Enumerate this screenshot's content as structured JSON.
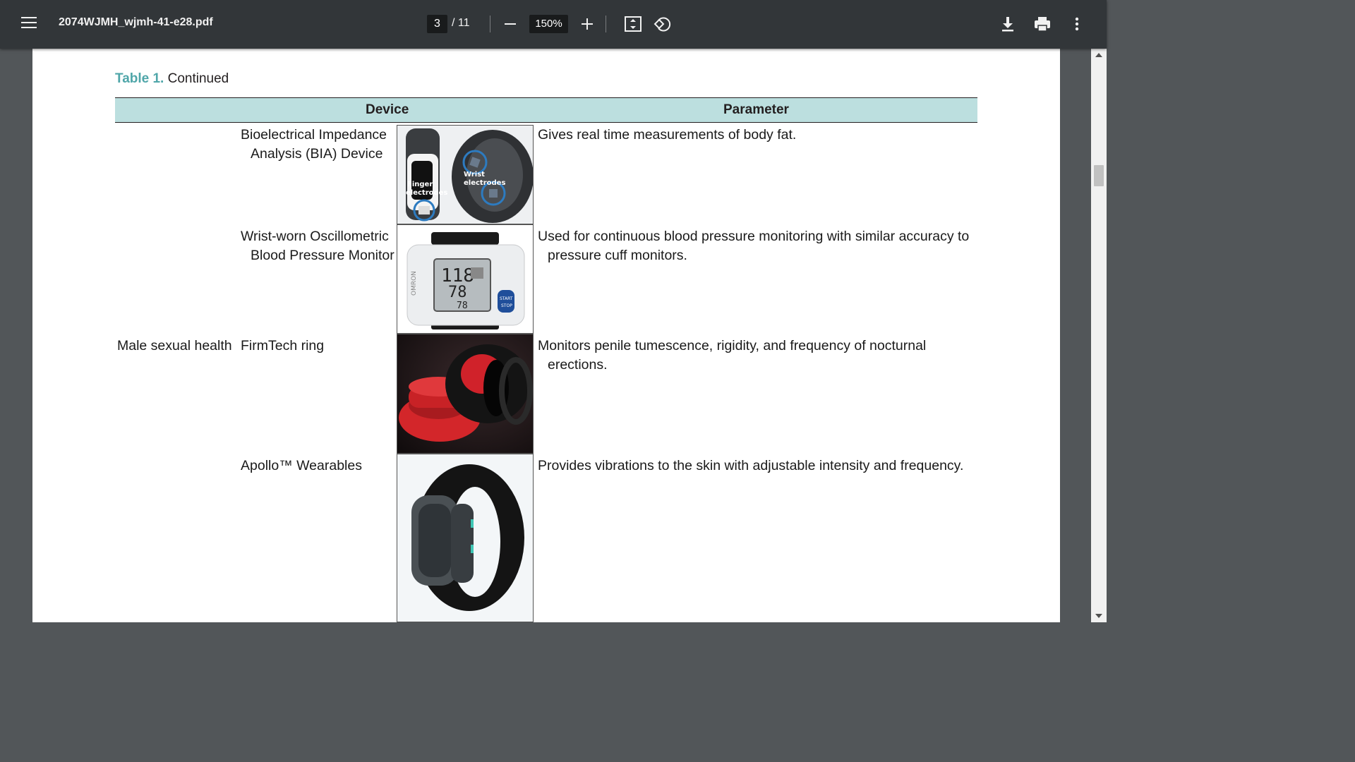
{
  "toolbar": {
    "file_name": "2074WJMH_wjmh-41-e28.pdf",
    "current_page": "3",
    "total_pages": "/ 11",
    "zoom": "150%"
  },
  "table": {
    "caption_label": "Table 1.",
    "caption_text": "Continued",
    "headers": {
      "device": "Device",
      "parameter": "Parameter"
    },
    "rows": [
      {
        "category": "",
        "device_line1": "Bioelectrical Impedance",
        "device_line2": "Analysis (BIA) Device",
        "param_line1": "Gives real time measurements of body fat.",
        "param_line2": "",
        "image_labels": {
          "finger": "Finger electrodes",
          "wrist": "Wrist electrodes"
        }
      },
      {
        "category": "",
        "device_line1": "Wrist-worn Oscillometric",
        "device_line2": "Blood Pressure Monitor",
        "param_line1": "Used for continuous blood pressure monitoring with similar accuracy to",
        "param_line2": "pressure cuff monitors.",
        "image_labels": {
          "brand": "OMRON",
          "sys": "118",
          "dia": "78",
          "pulse": "78",
          "button": "START STOP"
        }
      },
      {
        "category": "Male sexual health",
        "device_line1": "FirmTech ring",
        "device_line2": "",
        "param_line1": "Monitors penile tumescence, rigidity, and frequency of nocturnal",
        "param_line2": "erections."
      },
      {
        "category": "",
        "device_line1": "Apollo™ Wearables",
        "device_line2": "",
        "param_line1": "Provides vibrations to the skin with adjustable intensity and frequency.",
        "param_line2": ""
      }
    ]
  },
  "colors": {
    "toolbar_bg": "#323639",
    "viewer_bg": "#525659",
    "header_fill": "#bcdfdf",
    "caption_accent": "#4fa6a9"
  },
  "icons": [
    "menu-icon",
    "zoom-out-icon",
    "zoom-in-icon",
    "fit-page-icon",
    "rotate-icon",
    "download-icon",
    "print-icon",
    "more-options-icon"
  ]
}
